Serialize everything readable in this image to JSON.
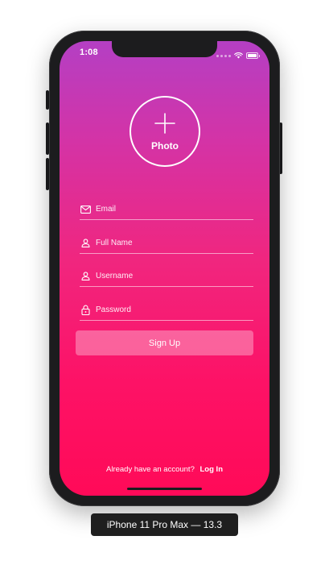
{
  "status_bar": {
    "time": "1:08",
    "battery_level": 1.0
  },
  "photo_picker": {
    "label": "Photo",
    "icon": "plus-icon"
  },
  "form": {
    "email": {
      "placeholder": "Email",
      "icon": "mail-icon"
    },
    "full_name": {
      "placeholder": "Full Name",
      "icon": "person-icon"
    },
    "username": {
      "placeholder": "Username",
      "icon": "person-icon"
    },
    "password": {
      "placeholder": "Password",
      "icon": "lock-icon"
    }
  },
  "signup_button": {
    "label": "Sign Up"
  },
  "login_prompt": {
    "text": "Already have an account?",
    "link": "Log In"
  },
  "device_label": "iPhone 11 Pro Max — 13.3",
  "colors": {
    "gradient_top": "#b43fc4",
    "gradient_bottom": "#ff0a58",
    "text": "#ffffff",
    "frame": "#1c1c1e"
  }
}
